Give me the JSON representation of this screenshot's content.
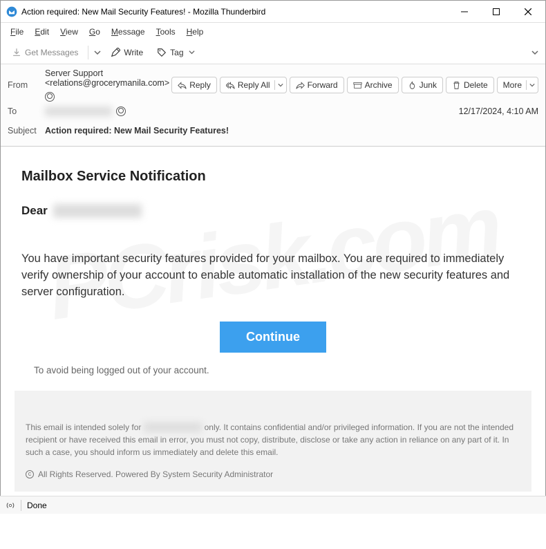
{
  "window": {
    "title": "Action required: New Mail Security Features! - Mozilla Thunderbird"
  },
  "menu": {
    "file": "File",
    "edit": "Edit",
    "view": "View",
    "go": "Go",
    "message": "Message",
    "tools": "Tools",
    "help": "Help"
  },
  "toolbar": {
    "get_messages": "Get Messages",
    "write": "Write",
    "tag": "Tag"
  },
  "headers": {
    "from_label": "From",
    "from_value": "Server Support <relations@grocerymanila.com>",
    "to_label": "To",
    "to_value_redacted": "██████████",
    "subject_label": "Subject",
    "subject_value": "Action required: New Mail Security Features!",
    "timestamp": "12/17/2024, 4:10 AM"
  },
  "actions": {
    "reply": "Reply",
    "reply_all": "Reply All",
    "forward": "Forward",
    "archive": "Archive",
    "junk": "Junk",
    "delete": "Delete",
    "more": "More"
  },
  "body": {
    "title": "Mailbox Service Notification",
    "greeting": "Dear",
    "greeting_redacted": "██████████",
    "paragraph": "You have important security features provided for your mailbox. You are required to immediately verify ownership of your account to enable automatic installation of the new security features and server configuration.",
    "cta": "Continue",
    "avoid_logout": "To avoid being logged out of your account.",
    "footer_pre": "This email is intended solely for ",
    "footer_redacted": "█████████",
    "footer_post": " only. It contains confidential and/or privileged information. If you are not the intended recipient or have received this email in error, you must not copy, distribute, disclose or take any action in reliance on any part of it. In such a case, you should inform us immediately and delete this email.",
    "rights": "All Rights Reserved. Powered By System Security Administrator"
  },
  "statusbar": {
    "text": "Done"
  }
}
